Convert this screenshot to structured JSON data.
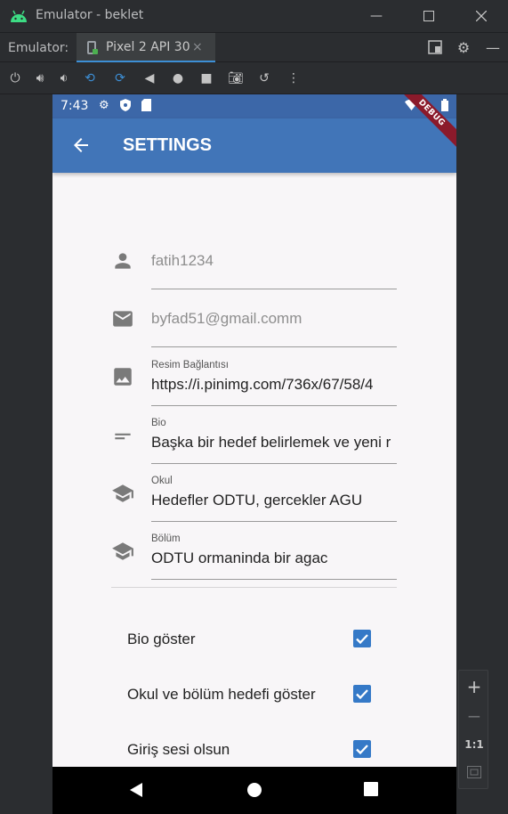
{
  "window": {
    "title": "Emulator - beklet",
    "minimize_icon": "minimize-icon",
    "maximize_icon": "maximize-icon",
    "close_icon": "close-icon"
  },
  "tabbar": {
    "label": "Emulator:",
    "tab_name": "Pixel 2 API 30",
    "tab_close": "×"
  },
  "status_bar": {
    "time": "7:43"
  },
  "appbar": {
    "title": "SETTINGS",
    "debug_banner": "DEBUG"
  },
  "form": {
    "username": {
      "value": "fatih1234"
    },
    "email": {
      "value": "byfad51@gmail.comm"
    },
    "image": {
      "label": "Resim Bağlantısı",
      "value": "https://i.pinimg.com/736x/67/58/4"
    },
    "bio": {
      "label": "Bio",
      "value": "Başka bir hedef belirlemek ve yeni r"
    },
    "school": {
      "label": "Okul",
      "value": "Hedefler ODTU, gercekler AGU"
    },
    "department": {
      "label": "Bölüm",
      "value": "ODTU ormaninda bir agac"
    }
  },
  "options": [
    {
      "label": "Bio göster",
      "checked": true
    },
    {
      "label": "Okul ve bölüm hedefi göster",
      "checked": true
    },
    {
      "label": "Giriş sesi olsun",
      "checked": true
    }
  ],
  "side_panel": {
    "zoom_in": "+",
    "zoom_out": "−",
    "one_to_one": "1:1"
  },
  "colors": {
    "appbar": "#4175b8",
    "status_bar": "#3c67a8",
    "checkbox": "#3579c7",
    "debug_banner": "#8b1a2b"
  }
}
